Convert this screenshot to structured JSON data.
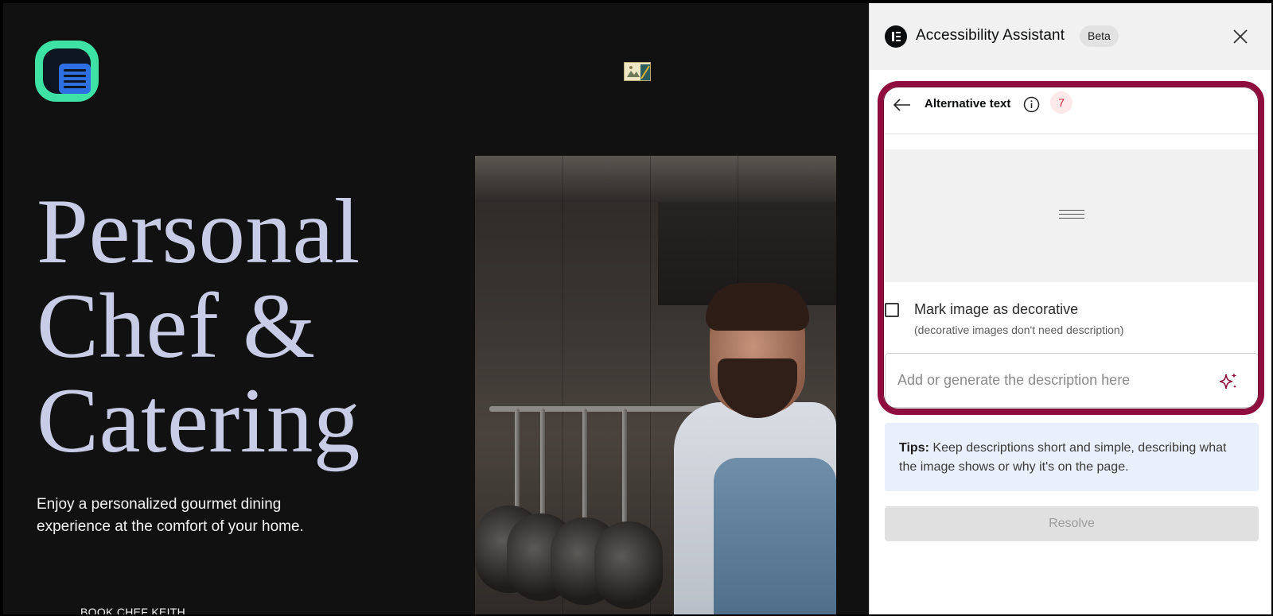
{
  "website": {
    "hero_title_line1": "Personal",
    "hero_title_line2": "Chef &",
    "hero_title_line3": "Catering",
    "subtitle_line1": "Enjoy a personalized gourmet dining",
    "subtitle_line2": "experience at the comfort of your home.",
    "cta_label": "BOOK CHEF KEITH",
    "logo_icon": "accessibility-document-icon",
    "broken_image_icon": "broken-image-icon",
    "colors": {
      "background": "#111112",
      "hero_text": "#c9cce6",
      "logo_ring": "#3ee2a4",
      "logo_doc": "#2f6fe4"
    }
  },
  "panel": {
    "title": "Accessibility Assistant",
    "badge": "Beta",
    "brand_icon": "elementor-logo-icon",
    "close_icon": "close-icon",
    "section": {
      "title": "Alternative text",
      "count": "7",
      "back_icon": "arrow-left-icon",
      "info_icon": "info-icon"
    },
    "preview_icon": "image-placeholder-icon",
    "decorative": {
      "label": "Mark image as decorative",
      "hint": "(decorative images don't need description)",
      "checked": false
    },
    "description": {
      "value": "",
      "placeholder": "Add or generate the description here",
      "generate_icon": "ai-sparkle-icon"
    },
    "tips": {
      "label": "Tips:",
      "text": "Keep descriptions short and simple, describing what the image shows or why it's on the page."
    },
    "resolve_label": "Resolve",
    "colors": {
      "highlight": "#8e0d3c",
      "badge_bg": "#fde8ea",
      "badge_text": "#c4213b",
      "tips_bg": "#eaf0fb"
    }
  }
}
